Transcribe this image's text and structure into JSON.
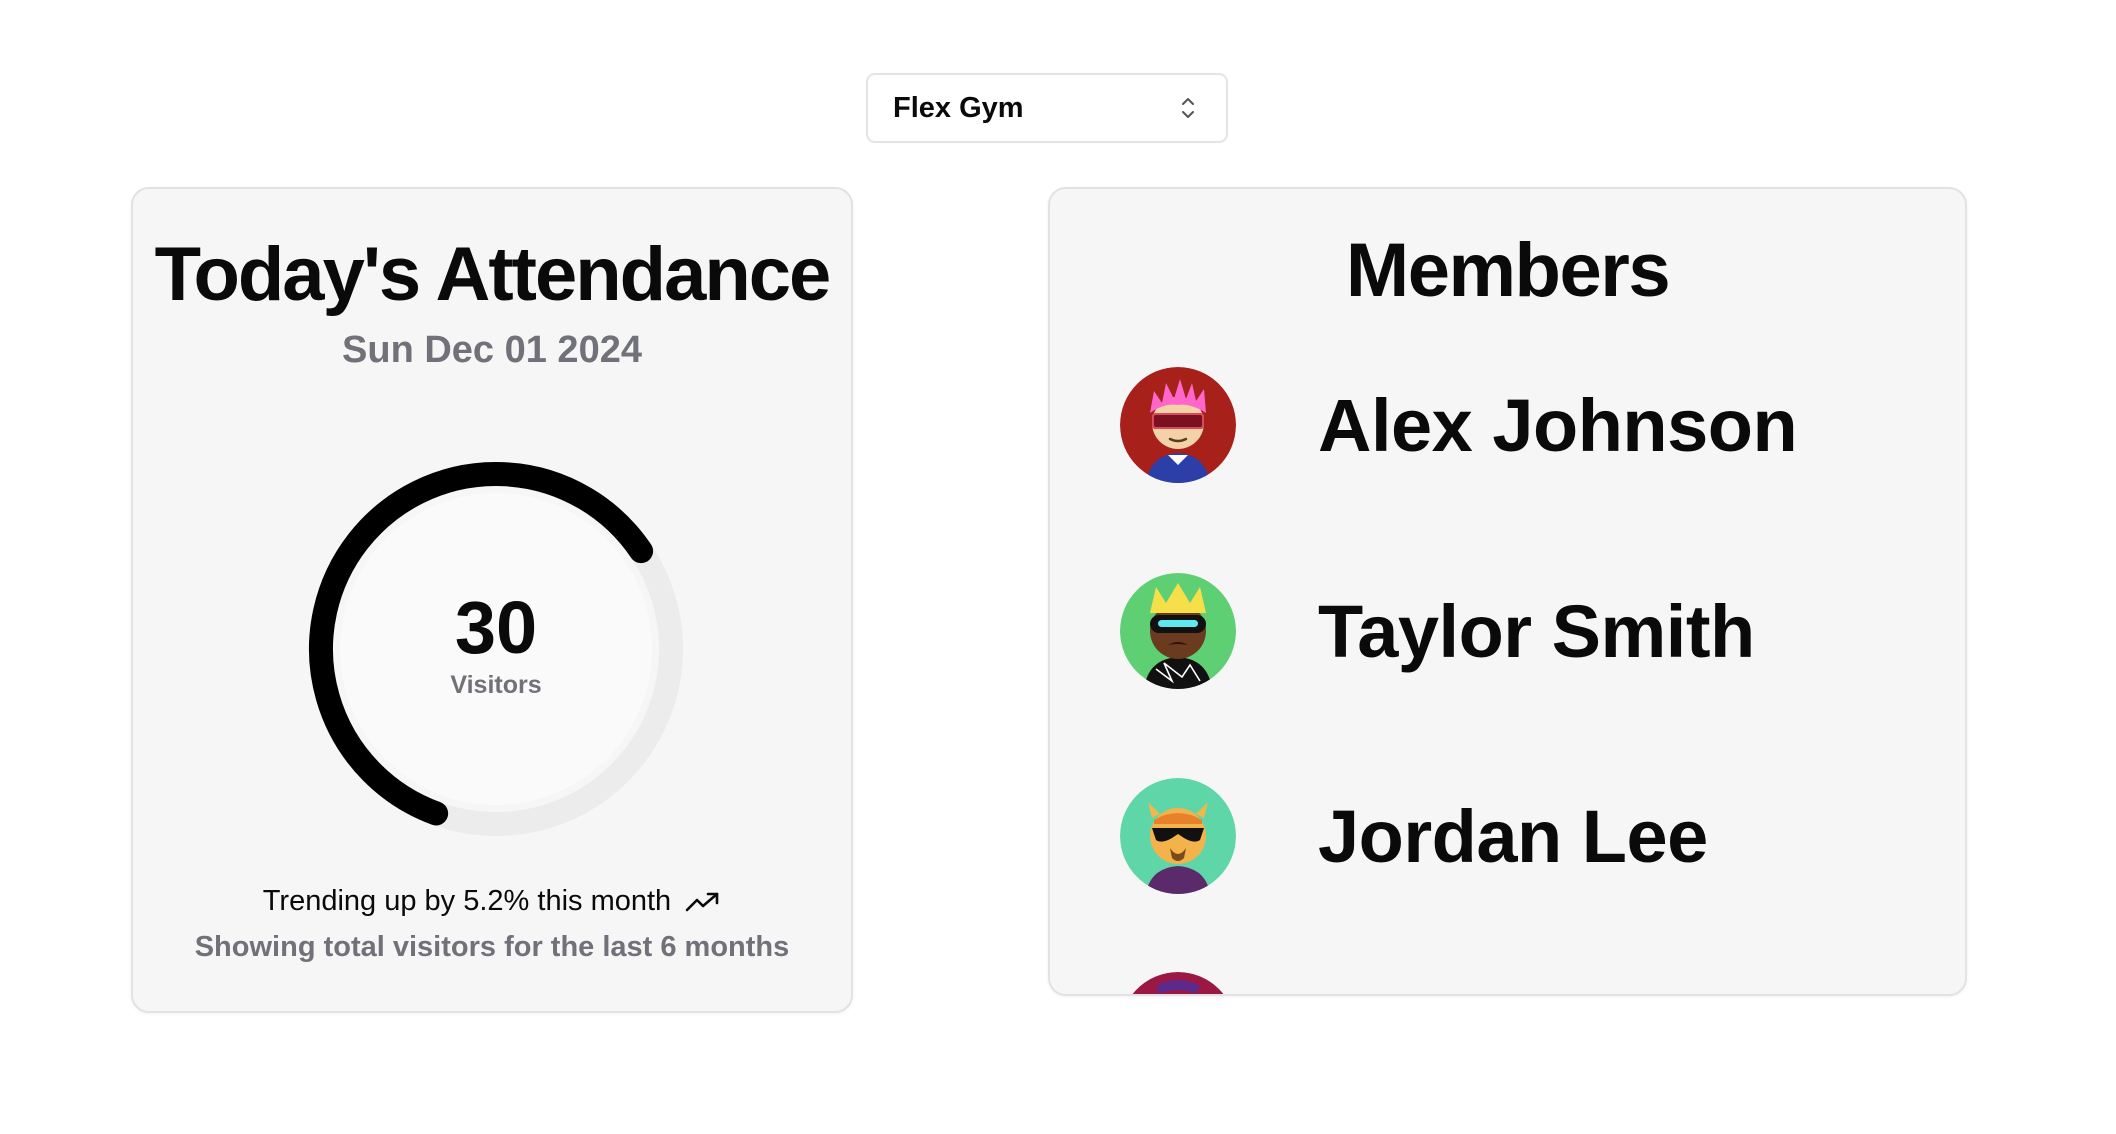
{
  "gym_select": {
    "value": "Flex Gym"
  },
  "attendance": {
    "title": "Today's Attendance",
    "date": "Sun Dec 01 2024",
    "visitors": "30",
    "visitors_label": "Visitors",
    "progress_fraction": 0.6,
    "trend_text": "Trending up by 5.2% this month",
    "caption": "Showing total visitors for the last 6 months"
  },
  "members": {
    "title": "Members",
    "items": [
      {
        "name": "Alex Johnson",
        "avatar_bg": "#a8201a",
        "icon": "avatar-pink-hair-glasses-icon"
      },
      {
        "name": "Taylor Smith",
        "avatar_bg": "#5fcf74",
        "icon": "avatar-crown-visor-icon"
      },
      {
        "name": "Jordan Lee",
        "avatar_bg": "#5ed6a8",
        "icon": "avatar-horns-sunglasses-icon"
      },
      {
        "name": "",
        "avatar_bg": "#9b1744",
        "icon": "avatar-partial-icon"
      }
    ]
  },
  "colors": {
    "gauge_fill": "#000000",
    "gauge_track": "#ececec",
    "muted_text": "#71717a"
  }
}
